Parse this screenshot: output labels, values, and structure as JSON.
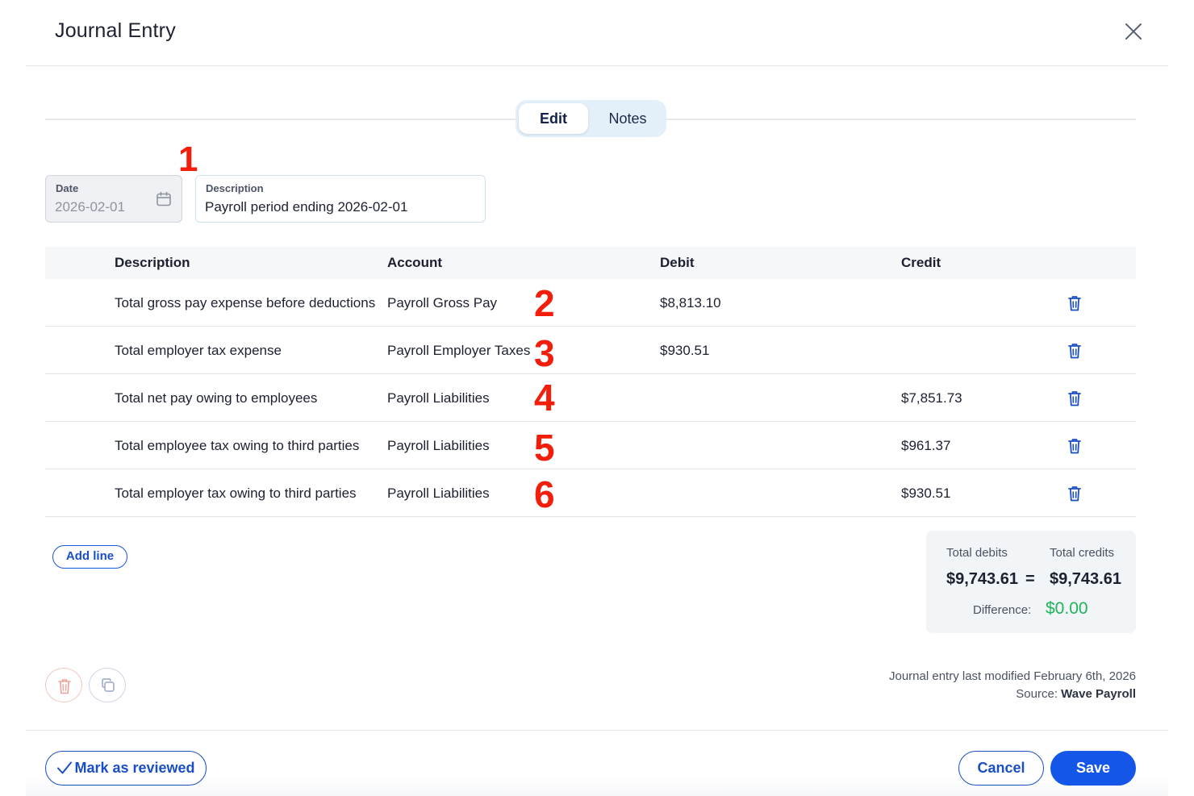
{
  "modal": {
    "title": "Journal Entry"
  },
  "tabs": [
    {
      "label": "Edit",
      "active": true
    },
    {
      "label": "Notes",
      "active": false
    }
  ],
  "markers": [
    "1",
    "2",
    "3",
    "4",
    "5",
    "6"
  ],
  "fields": {
    "date": {
      "label": "Date",
      "value": "2026-02-01"
    },
    "description": {
      "label": "Description",
      "value": "Payroll period ending 2026-02-01"
    }
  },
  "table": {
    "headers": {
      "description": "Description",
      "account": "Account",
      "debit": "Debit",
      "credit": "Credit"
    },
    "rows": [
      {
        "description": "Total gross pay expense before deductions",
        "account": "Payroll Gross Pay",
        "debit": "$8,813.10",
        "credit": ""
      },
      {
        "description": "Total employer tax expense",
        "account": "Payroll Employer Taxes",
        "debit": "$930.51",
        "credit": ""
      },
      {
        "description": "Total net pay owing to employees",
        "account": "Payroll Liabilities",
        "debit": "",
        "credit": "$7,851.73"
      },
      {
        "description": "Total employee tax owing to third parties",
        "account": "Payroll Liabilities",
        "debit": "",
        "credit": "$961.37"
      },
      {
        "description": "Total employer tax owing to third parties",
        "account": "Payroll Liabilities",
        "debit": "",
        "credit": "$930.51"
      }
    ]
  },
  "actions": {
    "add_line": "Add line"
  },
  "totals": {
    "debits_label": "Total debits",
    "credits_label": "Total credits",
    "debits": "$9,743.61",
    "equals": "=",
    "credits": "$9,743.61",
    "difference_label": "Difference:",
    "difference": "$0.00"
  },
  "meta": {
    "modified": "Journal entry last modified February 6th, 2026",
    "source_label": "Source:",
    "source": "Wave Payroll"
  },
  "footer": {
    "mark_reviewed": "Mark as reviewed",
    "cancel": "Cancel",
    "save": "Save"
  },
  "colors": {
    "primary": "#1457e8",
    "marker": "#f21d0a",
    "difference": "#20b55a",
    "tab_bg": "#e3f0fa"
  },
  "icons": [
    "close-icon",
    "calendar-icon",
    "trash-icon",
    "copy-icon",
    "checkmark-icon"
  ]
}
